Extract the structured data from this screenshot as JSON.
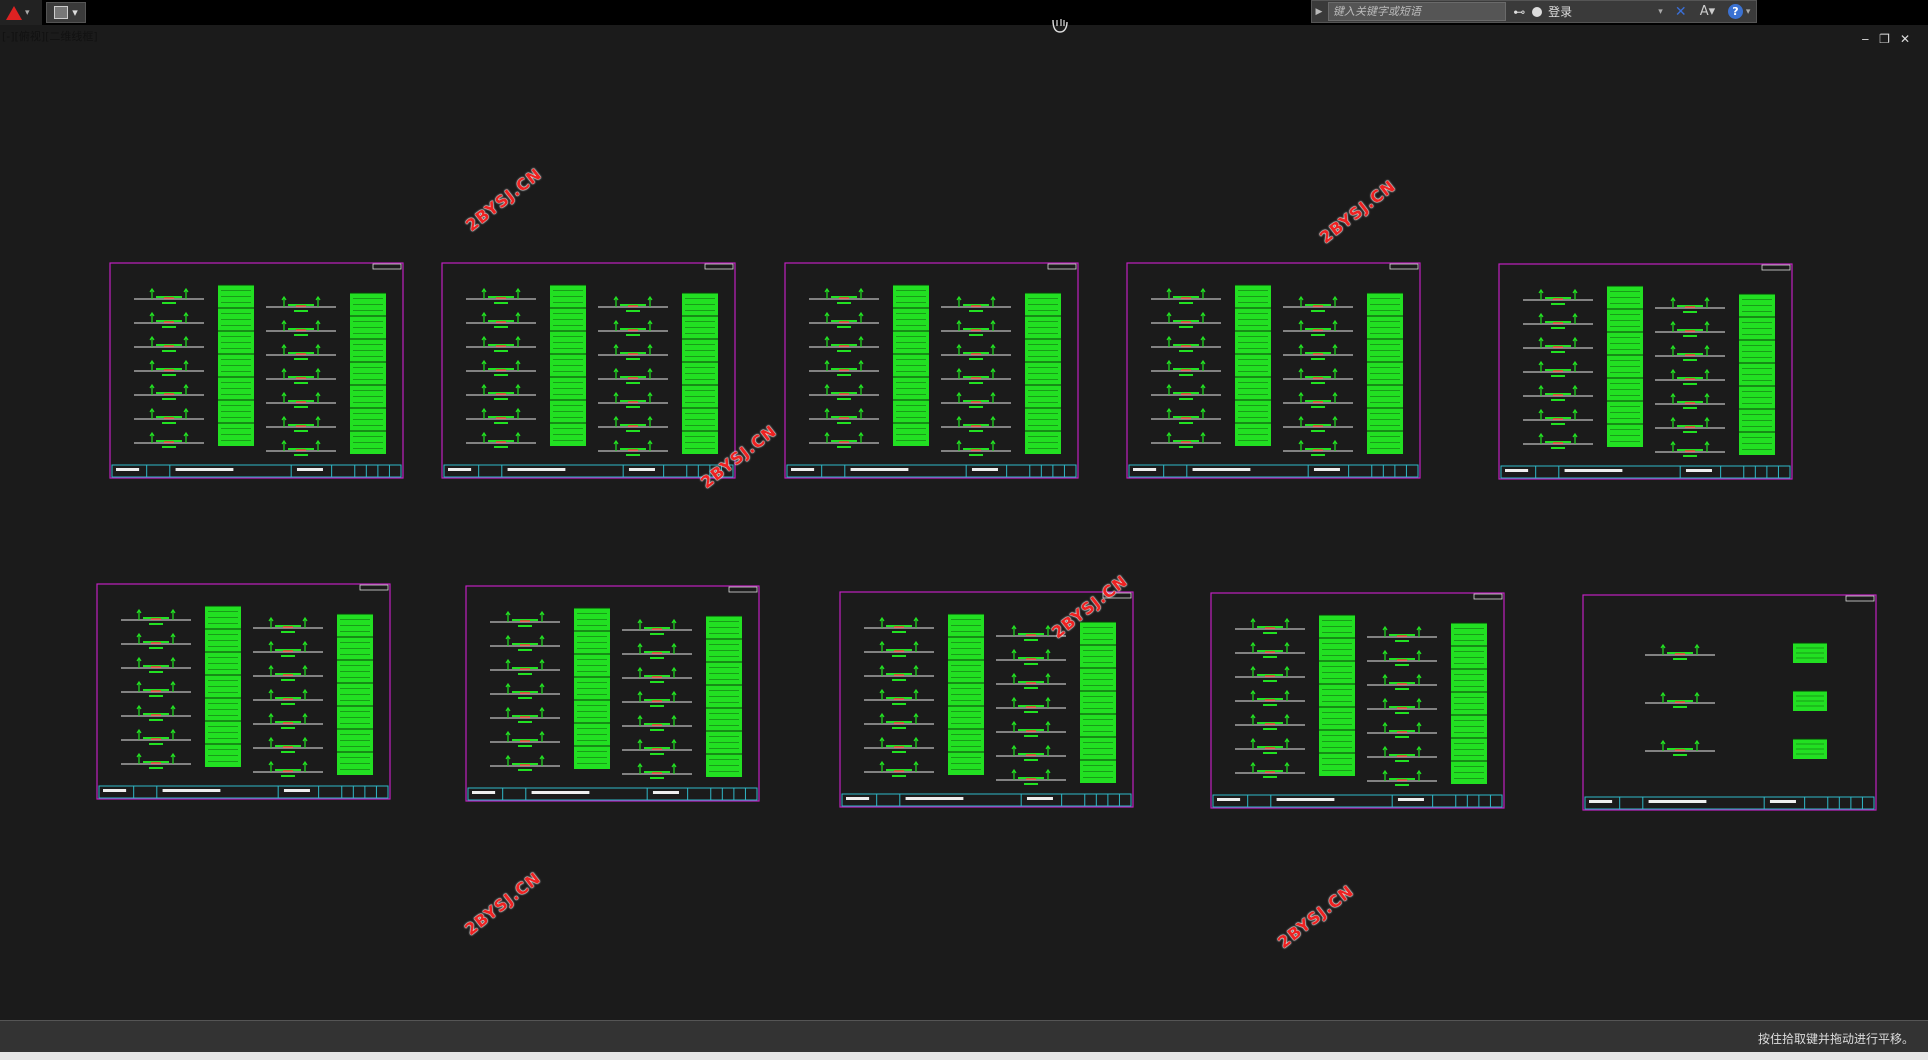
{
  "app": {
    "viewport_label": "[-][俯视][二维线框]",
    "qa_button": "",
    "infocenter": {
      "search_placeholder": "键入关键字或短语",
      "login_label": "登录"
    }
  },
  "window_controls": {
    "minimize": "‒",
    "restore": "❐",
    "close": "✕"
  },
  "watermark_text": "2BYSJ.CN",
  "status_bar": {
    "message": "按住拾取键并拖动进行平移。"
  },
  "colors": {
    "background": "#1b1b1b",
    "sheet_border": "#c020c0",
    "title_block": "#2fb8c8",
    "drawing_green": "#22e022",
    "watermark": "#ee2222"
  },
  "drawing": {
    "sheet_count": 10,
    "sheets": [
      {
        "id": 1,
        "row": 1,
        "col": 1,
        "sections": 14
      },
      {
        "id": 2,
        "row": 1,
        "col": 2,
        "sections": 14
      },
      {
        "id": 3,
        "row": 1,
        "col": 3,
        "sections": 14
      },
      {
        "id": 4,
        "row": 1,
        "col": 4,
        "sections": 14
      },
      {
        "id": 5,
        "row": 1,
        "col": 5,
        "sections": 14
      },
      {
        "id": 6,
        "row": 2,
        "col": 1,
        "sections": 14
      },
      {
        "id": 7,
        "row": 2,
        "col": 2,
        "sections": 14
      },
      {
        "id": 8,
        "row": 2,
        "col": 3,
        "sections": 14
      },
      {
        "id": 9,
        "row": 2,
        "col": 4,
        "sections": 14
      },
      {
        "id": 10,
        "row": 2,
        "col": 5,
        "sections": 3
      }
    ]
  }
}
